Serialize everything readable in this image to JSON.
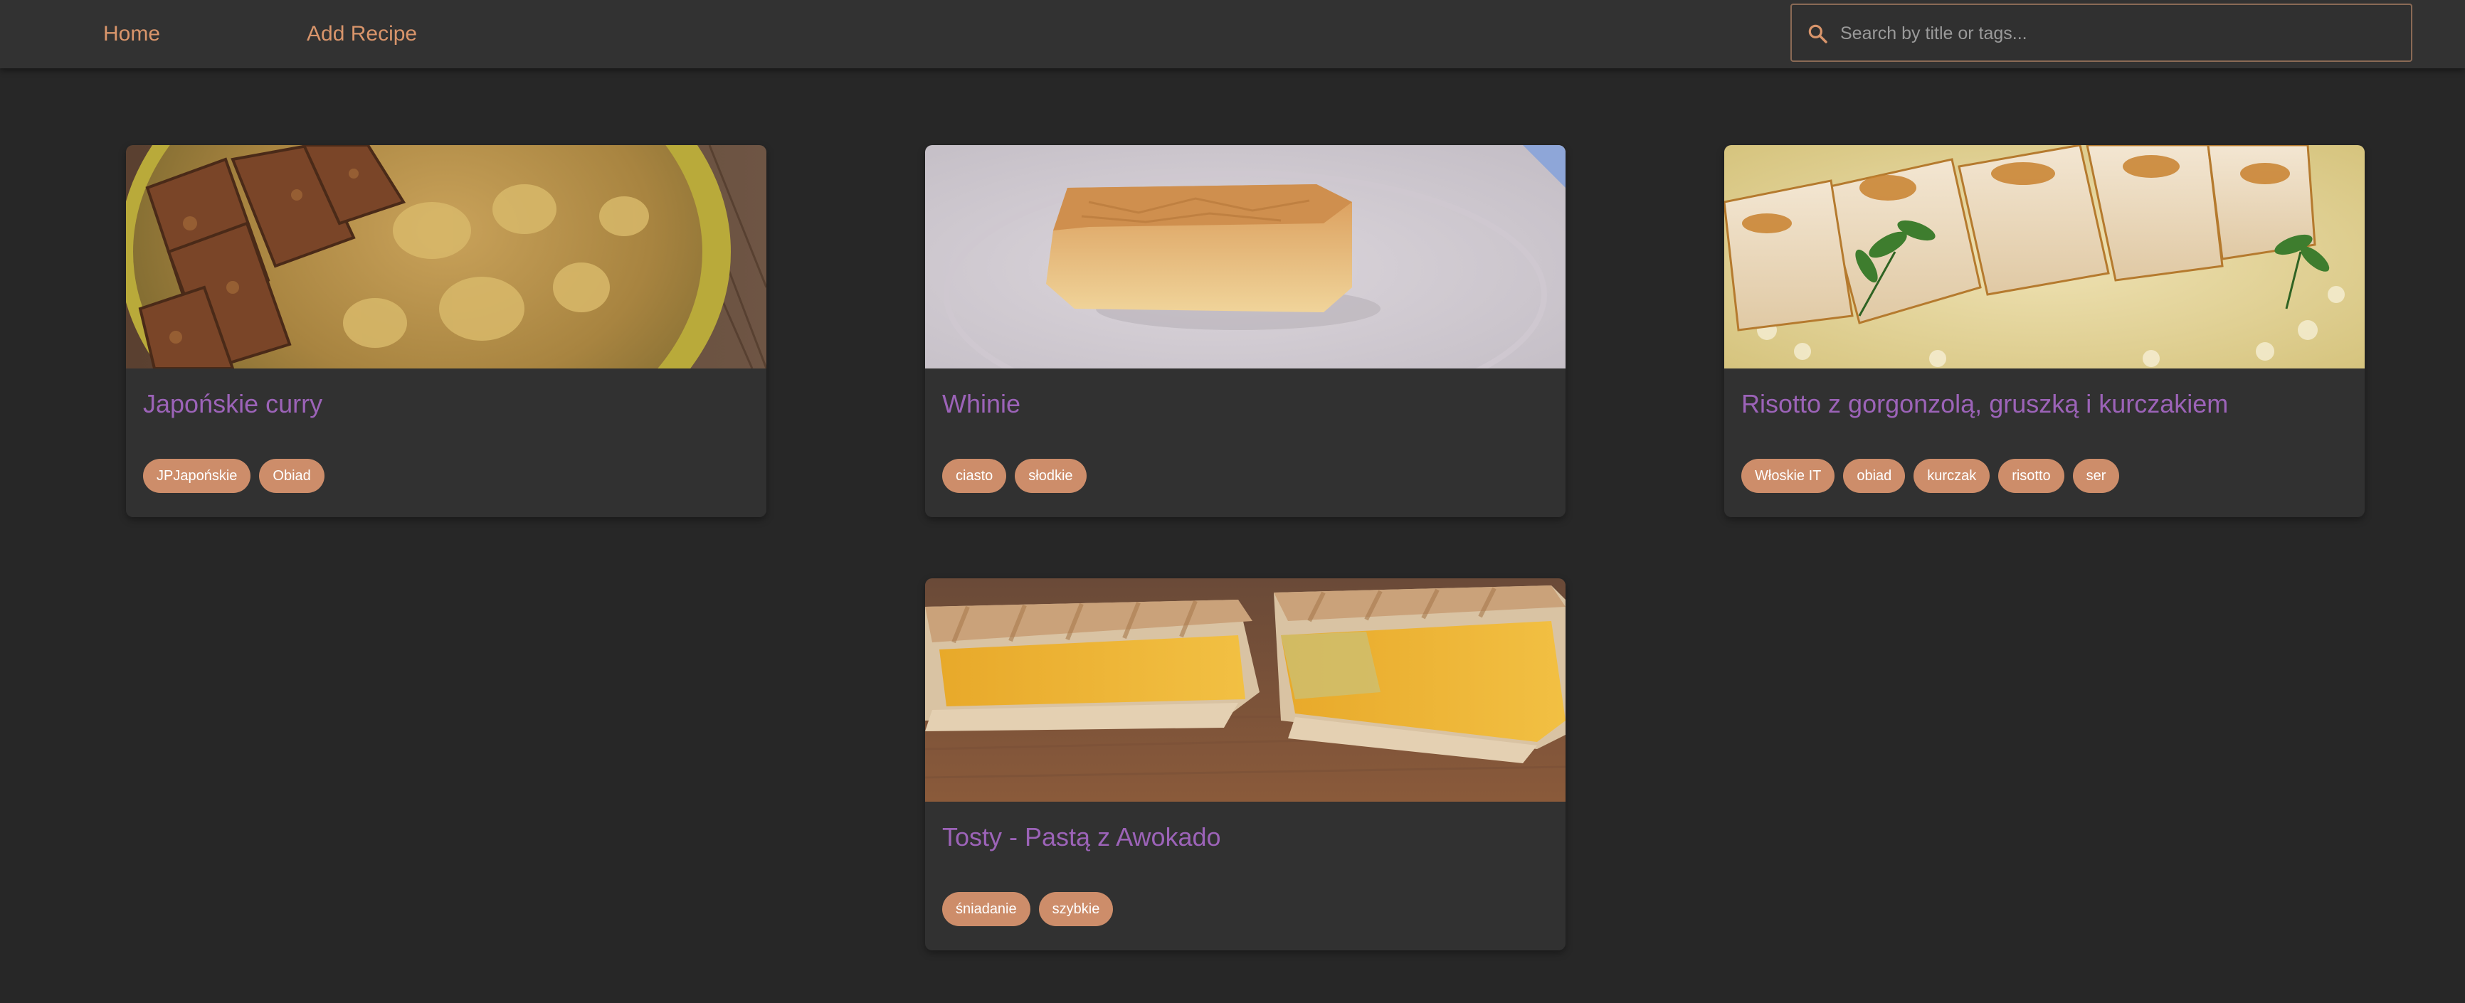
{
  "nav": {
    "home_label": "Home",
    "add_recipe_label": "Add Recipe"
  },
  "search": {
    "placeholder": "Search by title or tags...",
    "value": ""
  },
  "colors": {
    "background": "#272727",
    "navbar": "#323232",
    "accent": "#d9956b",
    "title": "#9c63b8",
    "tag": "#cd8d6a"
  },
  "recipes": [
    {
      "title": "Japońskie curry",
      "image": "japanese-curry-photo",
      "tags": [
        "JPJapońskie",
        "Obiad"
      ]
    },
    {
      "title": "Whinie",
      "image": "cake-slice-photo",
      "tags": [
        "ciasto",
        "słodkie"
      ]
    },
    {
      "title": "Risotto z gorgonzolą, gruszką i kurczakiem",
      "image": "chicken-risotto-photo",
      "tags": [
        "Włoskie IT",
        "obiad",
        "kurczak",
        "risotto",
        "ser"
      ]
    },
    {
      "title": "Tosty - Pastą z Awokado",
      "image": "toast-sandwich-photo",
      "tags": [
        "śniadanie",
        "szybkie"
      ]
    }
  ]
}
